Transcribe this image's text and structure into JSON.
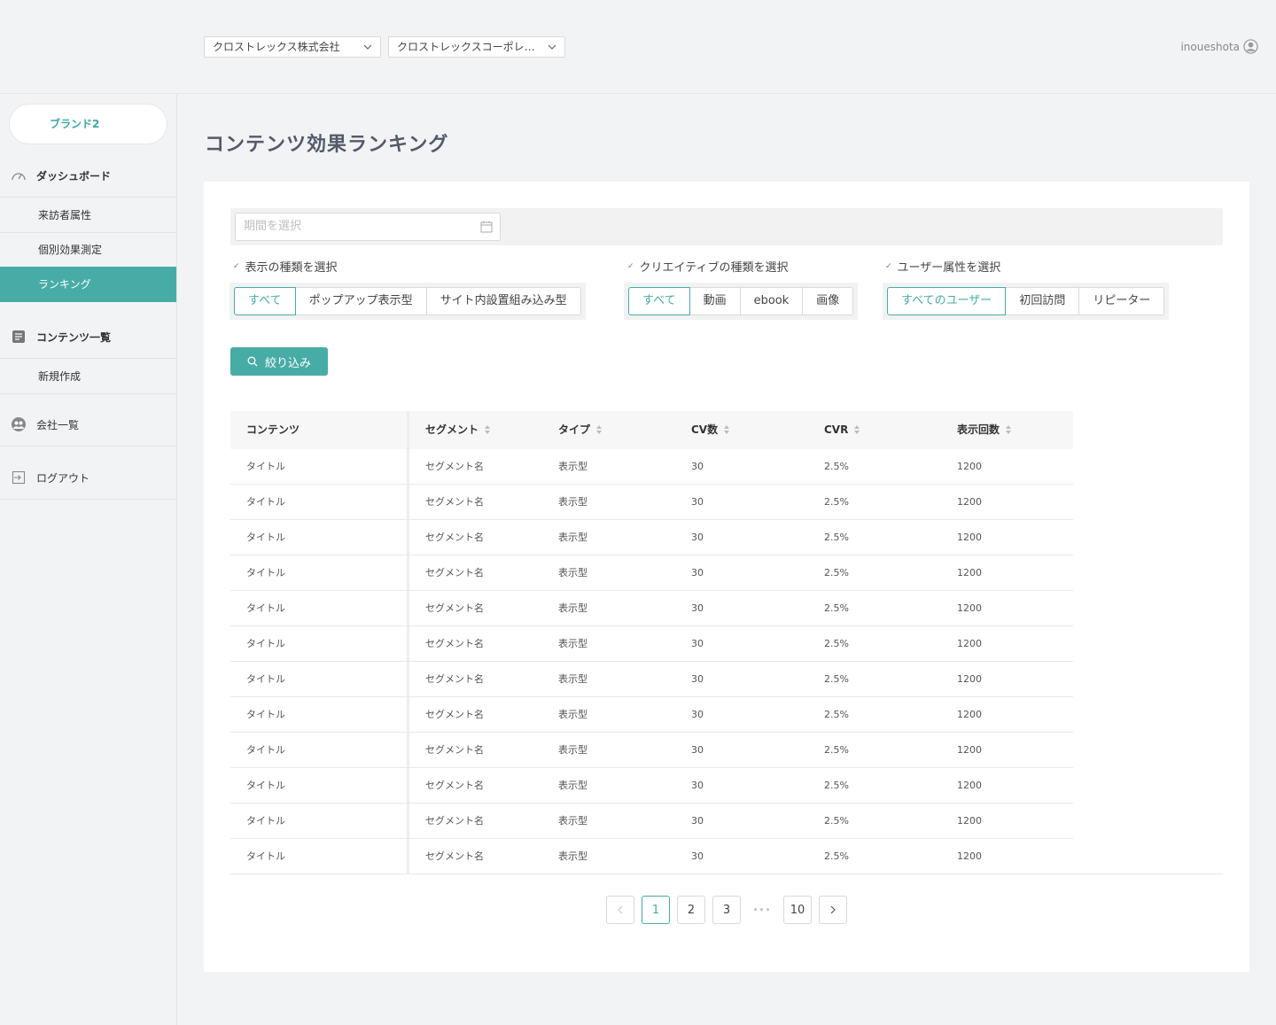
{
  "header": {
    "company_select": "クロストレックス株式会社",
    "corp_select": "クロストレックスコーポレ…",
    "username": "inoueshota"
  },
  "sidebar": {
    "brand": "ブランド2",
    "dashboard": "ダッシュボード",
    "visitor_attr": "来訪者属性",
    "individual": "個別効果測定",
    "ranking": "ランキング",
    "content_list": "コンテンツ一覧",
    "new": "新規作成",
    "companies": "会社一覧",
    "logout": "ログアウト"
  },
  "main": {
    "title": "コンテンツ効果ランキング",
    "date_placeholder": "期間を選択",
    "filter1": {
      "label": "表示の種類を選択",
      "options": [
        "すべて",
        "ポップアップ表示型",
        "サイト内設置組み込み型"
      ]
    },
    "filter2": {
      "label": "クリエイティブの種類を選択",
      "options": [
        "すべて",
        "動画",
        "ebook",
        "画像"
      ]
    },
    "filter3": {
      "label": "ユーザー属性を選択",
      "options": [
        "すべてのユーザー",
        "初回訪問",
        "リピーター"
      ]
    },
    "filter_button": "絞り込み"
  },
  "table": {
    "headers": [
      "コンテンツ",
      "セグメント",
      "タイプ",
      "CV数",
      "CVR",
      "表示回数"
    ],
    "rows": [
      [
        "タイトル",
        "セグメント名",
        "表示型",
        "30",
        "2.5%",
        "1200"
      ],
      [
        "タイトル",
        "セグメント名",
        "表示型",
        "30",
        "2.5%",
        "1200"
      ],
      [
        "タイトル",
        "セグメント名",
        "表示型",
        "30",
        "2.5%",
        "1200"
      ],
      [
        "タイトル",
        "セグメント名",
        "表示型",
        "30",
        "2.5%",
        "1200"
      ],
      [
        "タイトル",
        "セグメント名",
        "表示型",
        "30",
        "2.5%",
        "1200"
      ],
      [
        "タイトル",
        "セグメント名",
        "表示型",
        "30",
        "2.5%",
        "1200"
      ],
      [
        "タイトル",
        "セグメント名",
        "表示型",
        "30",
        "2.5%",
        "1200"
      ],
      [
        "タイトル",
        "セグメント名",
        "表示型",
        "30",
        "2.5%",
        "1200"
      ],
      [
        "タイトル",
        "セグメント名",
        "表示型",
        "30",
        "2.5%",
        "1200"
      ],
      [
        "タイトル",
        "セグメント名",
        "表示型",
        "30",
        "2.5%",
        "1200"
      ],
      [
        "タイトル",
        "セグメント名",
        "表示型",
        "30",
        "2.5%",
        "1200"
      ],
      [
        "タイトル",
        "セグメント名",
        "表示型",
        "30",
        "2.5%",
        "1200"
      ]
    ]
  },
  "pagination": {
    "pages": [
      "1",
      "2",
      "3",
      "•••",
      "10"
    ],
    "current": "1"
  },
  "colors": {
    "accent": "#48aca6",
    "background": "#f2f3f5",
    "panel": "#ffffff",
    "title": "#535a6a"
  }
}
